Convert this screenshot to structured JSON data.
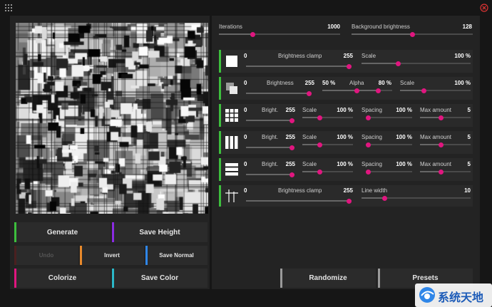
{
  "colors": {
    "accent_pink": "#e0167f",
    "accent_green": "#3dbf3d",
    "accent_purple": "#8b2be2",
    "accent_orange": "#e8892b",
    "accent_blue": "#2f86e8",
    "accent_pink2": "#e0167f",
    "accent_cyan": "#2bb8c8",
    "accent_grey": "#9a9a9a",
    "accent_dark": "#4a2020"
  },
  "icons": {
    "menu": "grid-dots-icon",
    "close": "close-circle-icon"
  },
  "top": {
    "iterations": {
      "label": "Iterations",
      "value": "1000",
      "fraction": 0.27
    },
    "bg": {
      "label": "Background brightness",
      "value": "128",
      "fraction": 0.5
    }
  },
  "rows": [
    {
      "icon": "square-icon",
      "min": "0",
      "clamp_label": "Brightness clamp",
      "clamp_max": "255",
      "clamp_fraction": 1.0,
      "scale_label": "Scale",
      "scale_value": "100 %",
      "scale_fraction": 0.33
    },
    {
      "icon": "overlap-squares-icon",
      "b_label": "Brightness",
      "b_min": "0",
      "b_max": "255",
      "b_fraction": 1.0,
      "alpha_min": "50 %",
      "alpha_label": "Alpha",
      "alpha_max": "80 %",
      "alpha_lo": 0.5,
      "alpha_hi": 0.8,
      "scale_label": "Scale",
      "scale_value": "100 %",
      "scale_fraction": 0.33
    },
    {
      "icon": "grid-squares-icon",
      "min": "0",
      "bright_label": "Bright.",
      "bright_max": "255",
      "bright_fraction": 1.0,
      "scale_label": "Scale",
      "scale_value": "100 %",
      "scale_fraction": 0.33,
      "spacing_label": "Spacing",
      "spacing_value": "100 %",
      "spacing_fraction": 0.0,
      "max_label": "Max amount",
      "max_value": "5",
      "max_fraction": 0.4
    },
    {
      "icon": "vertical-bars-icon",
      "min": "0",
      "bright_label": "Bright.",
      "bright_max": "255",
      "bright_fraction": 1.0,
      "scale_label": "Scale",
      "scale_value": "100 %",
      "scale_fraction": 0.33,
      "spacing_label": "Spacing",
      "spacing_value": "100 %",
      "spacing_fraction": 0.0,
      "max_label": "Max amount",
      "max_value": "5",
      "max_fraction": 0.4
    },
    {
      "icon": "horizontal-bars-icon",
      "min": "0",
      "bright_label": "Bright.",
      "bright_max": "255",
      "bright_fraction": 1.0,
      "scale_label": "Scale",
      "scale_value": "100 %",
      "scale_fraction": 0.33,
      "spacing_label": "Spacing",
      "spacing_value": "100 %",
      "spacing_fraction": 0.0,
      "max_label": "Max amount",
      "max_value": "5",
      "max_fraction": 0.4
    },
    {
      "icon": "crossing-lines-icon",
      "min": "0",
      "clamp_label": "Brightness clamp",
      "clamp_max": "255",
      "clamp_fraction": 1.0,
      "width_label": "Line width",
      "width_value": "10",
      "width_fraction": 0.2
    }
  ],
  "buttons": {
    "generate": "Generate",
    "save_height": "Save Height",
    "undo": "Undo",
    "invert": "Invert",
    "save_normal": "Save Normal",
    "colorize": "Colorize",
    "save_color": "Save Color",
    "randomize": "Randomize",
    "presets": "Presets"
  },
  "watermark": {
    "text": "系统天地"
  }
}
